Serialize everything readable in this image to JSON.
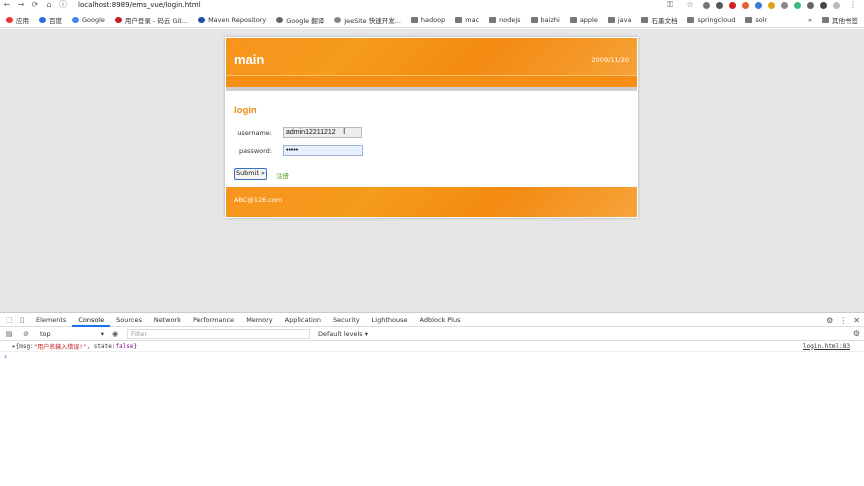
{
  "browser": {
    "url": "localhost:8989/ems_vue/login.html",
    "bookmarks": [
      {
        "label": "应用",
        "icon": "apps-grid-icon"
      },
      {
        "label": "百度",
        "icon": "baidu-icon"
      },
      {
        "label": "Google",
        "icon": "google-icon"
      },
      {
        "label": "用户登录 - 码云 Git...",
        "icon": "gitee-icon"
      },
      {
        "label": "Maven Repository",
        "icon": "maven-icon"
      },
      {
        "label": "Google 翻译",
        "icon": "translate-icon"
      },
      {
        "label": "JeeSite 快速开发...",
        "icon": "jeesite-icon"
      },
      {
        "label": "hadoop",
        "icon": "folder-icon"
      },
      {
        "label": "mac",
        "icon": "folder-icon"
      },
      {
        "label": "nodejs",
        "icon": "folder-icon"
      },
      {
        "label": "baizhi",
        "icon": "folder-icon"
      },
      {
        "label": "apple",
        "icon": "folder-icon"
      },
      {
        "label": "java",
        "icon": "folder-icon"
      },
      {
        "label": "石墨文档",
        "icon": "folder-icon"
      },
      {
        "label": "springcloud",
        "icon": "folder-icon"
      },
      {
        "label": "solr",
        "icon": "folder-icon"
      }
    ],
    "more_bookmarks": "»",
    "other_bookmarks": "其他书签"
  },
  "app": {
    "brand": "main",
    "date": "2009/11/20",
    "login_title": "login",
    "username_label": "username:",
    "username_value": "admin12211212",
    "password_label": "password:",
    "password_value": "•••••",
    "submit_label": "Submit »",
    "register_label": "注册",
    "footer_email": "ABC@126.com"
  },
  "devtools": {
    "tabs": [
      "Elements",
      "Console",
      "Sources",
      "Network",
      "Performance",
      "Memory",
      "Application",
      "Security",
      "Lighthouse",
      "Adblock Plus"
    ],
    "active_tab": "Console",
    "context": "top",
    "filter_placeholder": "Filter",
    "levels": "Default levels ▾",
    "log": {
      "prefix": "▸{msg: ",
      "msg": "\"用户名输入错误!\"",
      "mid": ", state: ",
      "state": "false",
      "suffix": "}",
      "source": "login.html:83"
    },
    "prompt": "›"
  },
  "colors": {
    "accent_orange": "#f7941d",
    "title_orange": "#e98b17",
    "link_green": "#5a9c2d",
    "devtools_blue": "#1a73e8"
  }
}
